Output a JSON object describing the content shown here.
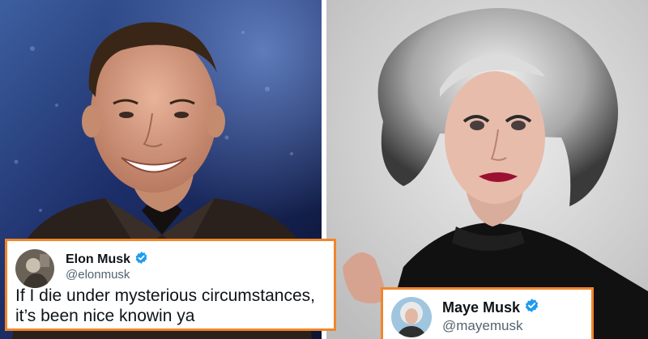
{
  "tweets": [
    {
      "display_name": "Elon Musk",
      "handle": "@elonmusk",
      "verified": true,
      "text_line1": "If I die under mysterious circumstances,",
      "text_line2": "it’s been nice knowin ya"
    },
    {
      "display_name": "Maye Musk",
      "handle": "@mayemusk",
      "verified": true
    }
  ],
  "colors": {
    "frame_border": "#f0862b",
    "verified_badge": "#1d9bf0",
    "name_text": "#0f1419",
    "handle_text": "#536471"
  },
  "icons": [
    "verified-badge-icon"
  ]
}
